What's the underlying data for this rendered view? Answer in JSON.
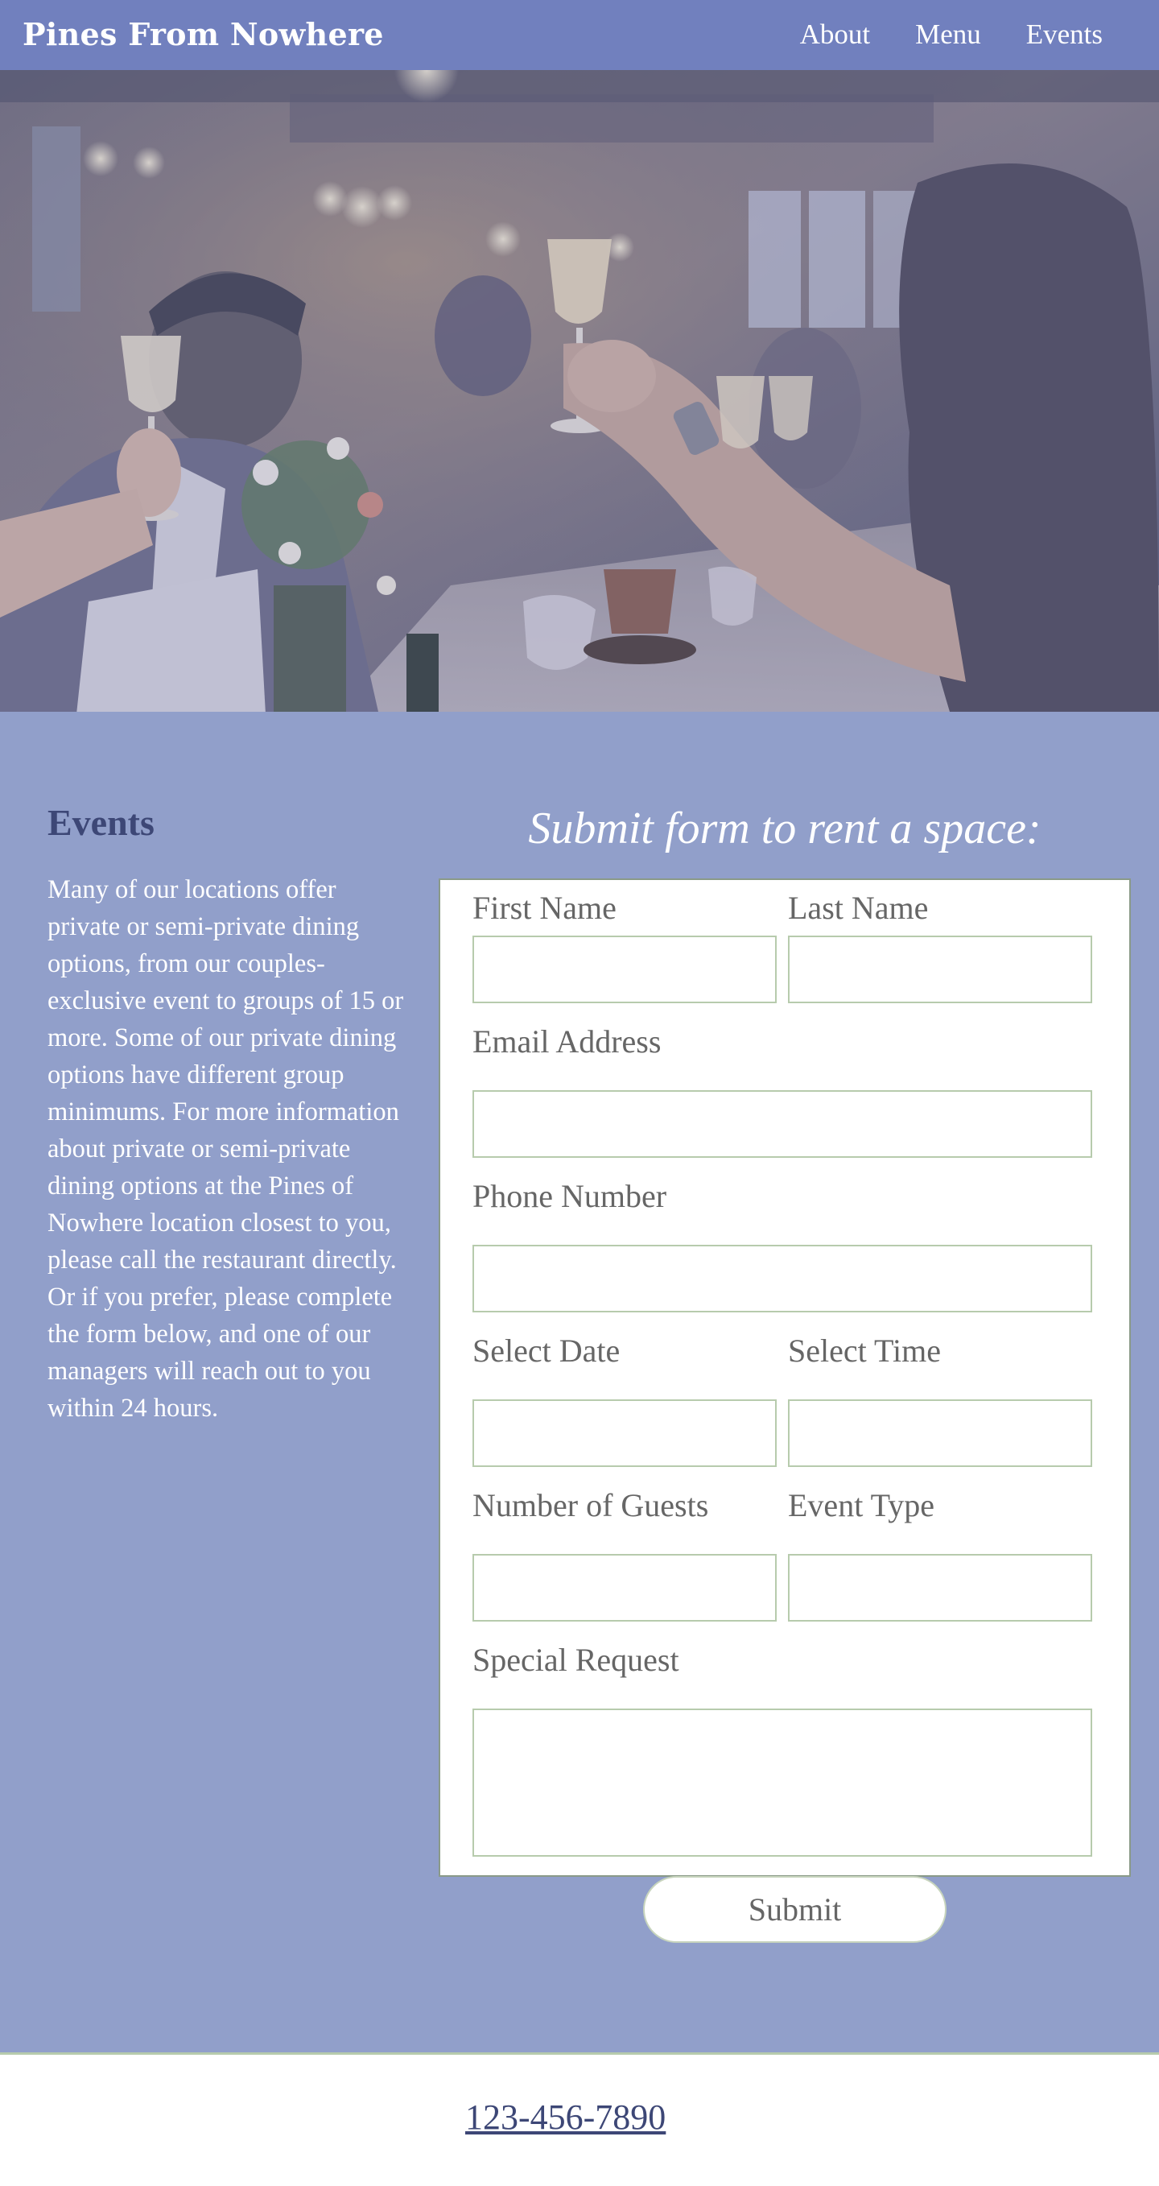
{
  "header": {
    "brand": "Pines From Nowhere",
    "nav": [
      "About",
      "Menu",
      "Events"
    ]
  },
  "hero": {
    "alt": "Guests raising champagne glasses in a toast at a restaurant dining event"
  },
  "events": {
    "title": "Events",
    "description": "Many of our locations offer private or semi-private dining options, from our couples-exclusive event to groups of 15 or more. Some of our private dining options have different group minimums. For more information about private or semi-private dining options at the Pines of Nowhere location closest to you, please call the restaurant directly. Or if you prefer, please complete the form below, and one of our managers will reach out to you within 24 hours."
  },
  "form": {
    "heading": "Submit form to rent a space:",
    "first_name_label": "First Name",
    "last_name_label": "Last Name",
    "email_label": "Email Address",
    "phone_label": "Phone Number",
    "date_label": "Select Date",
    "time_label": "Select Time",
    "guests_label": "Number of Guests",
    "event_type_label": "Event Type",
    "special_request_label": "Special Request",
    "submit_label": "Submit"
  },
  "footer": {
    "phone": "123-456-7890"
  },
  "colors": {
    "header_bg": "#7180be",
    "section_bg": "#919fca",
    "title_color": "#3d4776",
    "field_border": "#b7cbad",
    "label_color": "#666666"
  }
}
